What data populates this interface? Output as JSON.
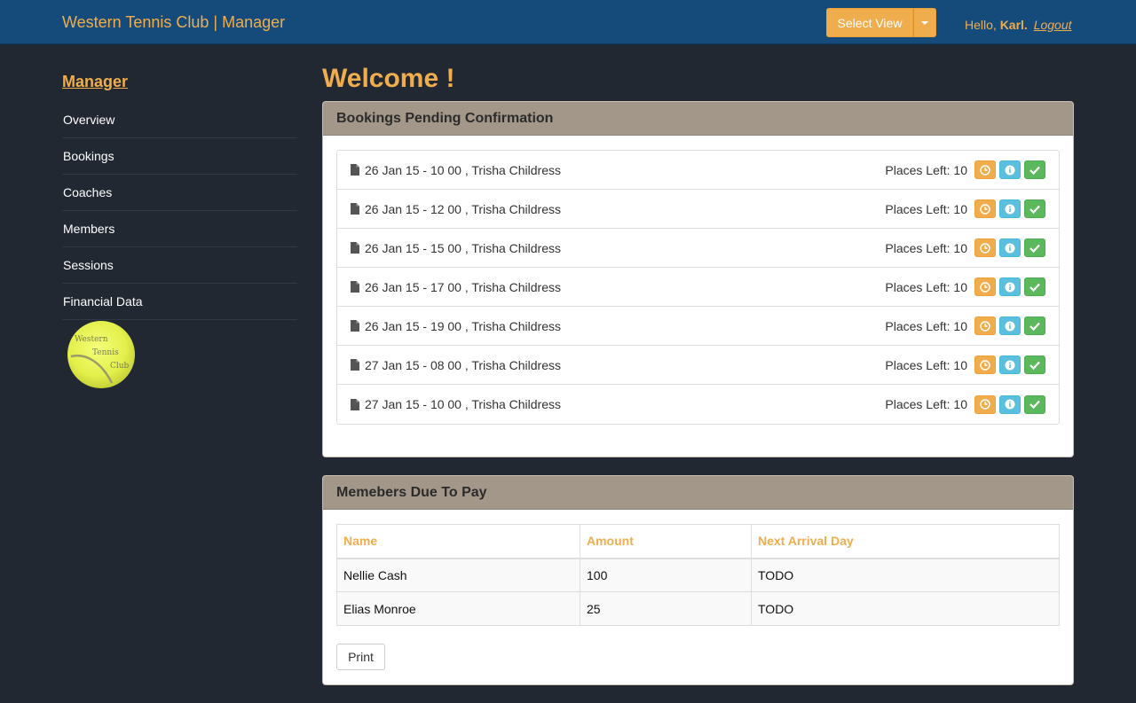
{
  "header": {
    "brand": "Western Tennis Club | Manager",
    "select_view_label": "Select View",
    "greeting_prefix": "Hello,",
    "user_name": "Karl.",
    "logout_label": "Logout"
  },
  "sidebar": {
    "title": "Manager",
    "items": [
      {
        "label": "Overview"
      },
      {
        "label": "Bookings"
      },
      {
        "label": "Coaches"
      },
      {
        "label": "Members"
      },
      {
        "label": "Sessions"
      },
      {
        "label": "Financial Data"
      }
    ],
    "logo_text": [
      "Western",
      "Tennis",
      "Club"
    ]
  },
  "main": {
    "welcome": "Welcome !",
    "pending": {
      "title": "Bookings Pending Confirmation",
      "items": [
        {
          "text": "26 Jan 15 - 10 00 , Trisha Childress",
          "places": "Places Left: 10"
        },
        {
          "text": "26 Jan 15 - 12 00 , Trisha Childress",
          "places": "Places Left: 10"
        },
        {
          "text": "26 Jan 15 - 15 00 , Trisha Childress",
          "places": "Places Left: 10"
        },
        {
          "text": "26 Jan 15 - 17 00 , Trisha Childress",
          "places": "Places Left: 10"
        },
        {
          "text": "26 Jan 15 - 19 00 , Trisha Childress",
          "places": "Places Left: 10"
        },
        {
          "text": "27 Jan 15 - 08 00 , Trisha Childress",
          "places": "Places Left: 10"
        },
        {
          "text": "27 Jan 15 - 10 00 , Trisha Childress",
          "places": "Places Left: 10"
        }
      ]
    },
    "due": {
      "title": "Memebers Due To Pay",
      "columns": [
        "Name",
        "Amount",
        "Next Arrival Day"
      ],
      "rows": [
        [
          "Nellie Cash",
          "100",
          "TODO"
        ],
        [
          "Elias Monroe",
          "25",
          "TODO"
        ]
      ],
      "print_label": "Print"
    }
  },
  "colors": {
    "accent": "#f0ad4e",
    "topbar": "#154b7b",
    "background": "#212832",
    "panel_heading": "#a3978a",
    "info": "#5bc0de",
    "success": "#5cb85c"
  },
  "icons": [
    "file-icon",
    "clock-icon",
    "info-icon",
    "check-icon",
    "caret-down-icon"
  ]
}
